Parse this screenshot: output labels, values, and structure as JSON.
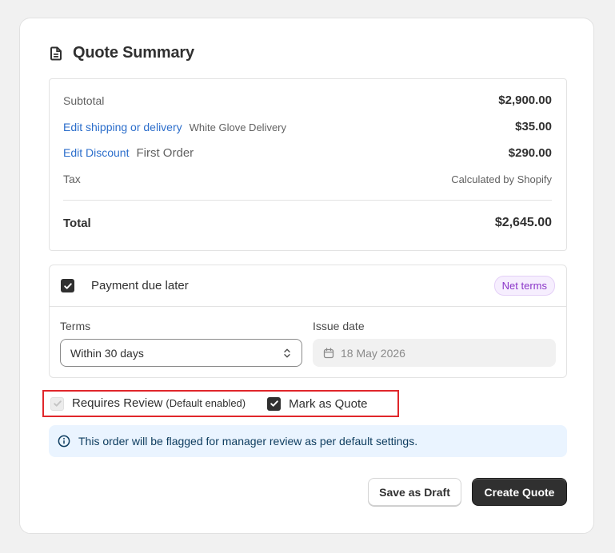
{
  "header": {
    "title": "Quote Summary",
    "icon": "document-icon"
  },
  "summary": {
    "subtotal": {
      "label": "Subtotal",
      "amount": "$2,900.00"
    },
    "shipping": {
      "link": "Edit shipping or delivery",
      "detail": "White Glove Delivery",
      "amount": "$35.00"
    },
    "discount": {
      "link": "Edit Discount",
      "detail": "First Order",
      "amount": "$290.00"
    },
    "tax": {
      "label": "Tax",
      "amount": "Calculated by Shopify"
    },
    "total": {
      "label": "Total",
      "amount": "$2,645.00"
    }
  },
  "payment": {
    "checkbox_checked": true,
    "label": "Payment due later",
    "badge": "Net terms",
    "terms": {
      "label": "Terms",
      "value": "Within 30 days"
    },
    "issue_date": {
      "label": "Issue date",
      "value": "18 May 2026"
    }
  },
  "options": {
    "requires_review": {
      "label": "Requires Review",
      "note": "(Default enabled)",
      "checked": true,
      "disabled": true
    },
    "mark_as_quote": {
      "label": "Mark as Quote",
      "checked": true
    }
  },
  "banner": {
    "text": "This order will be flagged for manager review as per default settings."
  },
  "actions": {
    "save_draft": "Save as Draft",
    "create_quote": "Create Quote"
  },
  "colors": {
    "link": "#2c6ecb",
    "badge_text": "#8a35c8",
    "badge_bg": "#f6eefe",
    "primary_button": "#303030",
    "banner_bg": "#eaf4ff",
    "highlight_border": "#e0262b"
  }
}
